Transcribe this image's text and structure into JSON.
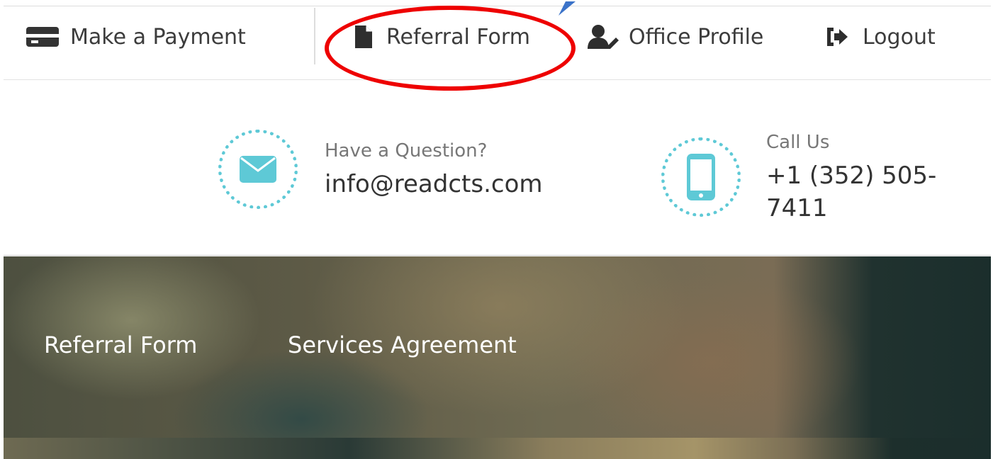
{
  "topnav": {
    "items": [
      {
        "label": "Make a Payment",
        "icon": "credit-card-icon"
      },
      {
        "label": "Referral Form",
        "icon": "file-icon"
      },
      {
        "label": "Office Profile",
        "icon": "user-edit-icon"
      },
      {
        "label": "Logout",
        "icon": "sign-out-icon"
      }
    ]
  },
  "contact": {
    "email": {
      "caption": "Have a Question?",
      "value": "info@readcts.com",
      "icon": "envelope-icon"
    },
    "phone": {
      "caption": "Call Us",
      "value": "+1 (352) 505-7411",
      "icon": "mobile-phone-icon"
    }
  },
  "hero": {
    "links": [
      {
        "label": "Referral Form"
      },
      {
        "label": "Services Agreement"
      }
    ]
  },
  "colors": {
    "accent": "#5ec9d6",
    "annotation": "#ee0000",
    "arrow": "#3b73c9",
    "text": "#3c3c3c"
  }
}
